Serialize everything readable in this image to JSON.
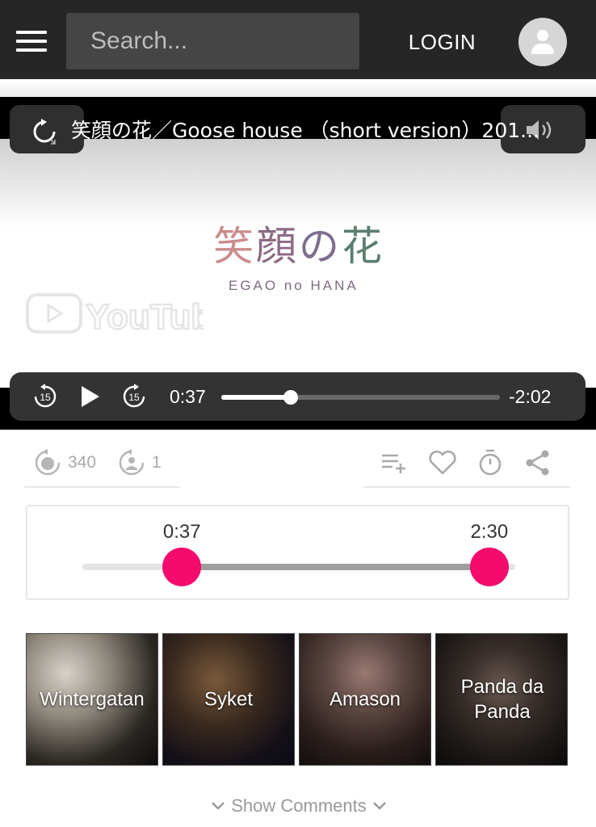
{
  "header": {
    "menu_icon": "hamburger-icon",
    "search_placeholder": "Search...",
    "login_label": "LOGIN",
    "avatar_icon": "person-icon"
  },
  "player": {
    "title": "笑顔の花／Goose house （short version）201...",
    "logo_jp": [
      "笑",
      "顔",
      "の",
      "花"
    ],
    "logo_en": "EGAO no HANA",
    "watermark": "YouTube",
    "current_time": "0:37",
    "remaining_time": "-2:02",
    "progress": 0.25,
    "rewind_label": "15",
    "forward_label": "15",
    "icons": [
      "replay-icon",
      "volume-icon",
      "rewind-15-icon",
      "play-icon",
      "forward-15-icon"
    ]
  },
  "stats": {
    "loops": "340",
    "users": "1",
    "actions": [
      "add-to-playlist-icon",
      "heart-icon",
      "timer-icon",
      "share-icon"
    ]
  },
  "range": {
    "start_label": "0:37",
    "end_label": "2:30",
    "start_fraction": 0.23,
    "end_fraction": 0.94,
    "thumb_color": "#f50a6e"
  },
  "related": [
    {
      "label": "Wintergatan"
    },
    {
      "label": "Syket"
    },
    {
      "label": "Amason"
    },
    {
      "label": "Panda da Panda"
    }
  ],
  "comments": {
    "toggle_label": "Show Comments"
  }
}
